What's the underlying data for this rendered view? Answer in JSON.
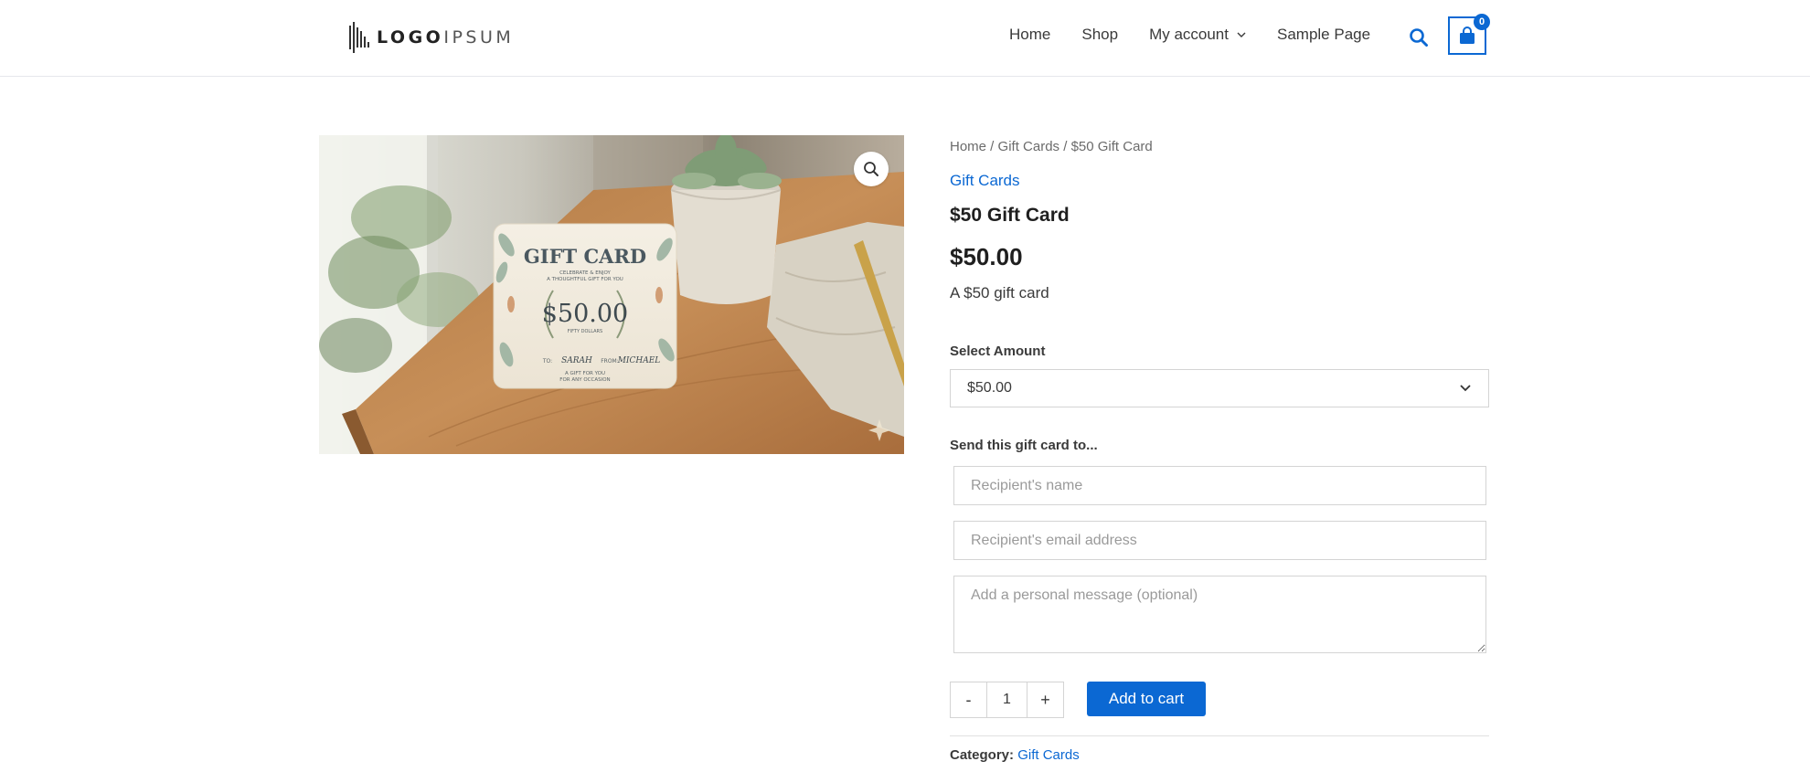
{
  "header": {
    "logo": {
      "bold": "LOGO",
      "light": "IPSUM"
    },
    "nav": [
      {
        "label": "Home"
      },
      {
        "label": "Shop"
      },
      {
        "label": "My account"
      },
      {
        "label": "Sample Page"
      }
    ],
    "cart_count": "0",
    "accent": "#0b68d3"
  },
  "product_image": {
    "card_title": "GIFT CARD",
    "card_line1": "CELEBRATE & ENJOY",
    "card_line2": "A THOUGHTFUL GIFT FOR YOU",
    "card_amount": "$50.00",
    "card_amount_words": "FIFTY DOLLARS",
    "card_to_label": "TO:",
    "card_to": "SARAH",
    "card_from_label": "FROM:",
    "card_from": "MICHAEL",
    "card_footer1": "A GIFT FOR YOU",
    "card_footer2": "FOR ANY OCCASION"
  },
  "breadcrumb": {
    "home": "Home",
    "sep": " / ",
    "category": "Gift Cards",
    "current": "$50 Gift Card"
  },
  "product": {
    "category": "Gift Cards",
    "title": "$50 Gift Card",
    "price": "$50.00",
    "description": "A $50 gift card"
  },
  "amount": {
    "label": "Select Amount",
    "selected": "$50.00"
  },
  "recipient": {
    "label": "Send this gift card to...",
    "name_placeholder": "Recipient's name",
    "email_placeholder": "Recipient's email address",
    "message_placeholder": "Add a personal message (optional)"
  },
  "cart": {
    "minus": "-",
    "quantity": "1",
    "plus": "+",
    "add_label": "Add to cart"
  },
  "meta": {
    "category_label": "Category:",
    "category_value": "Gift Cards"
  }
}
